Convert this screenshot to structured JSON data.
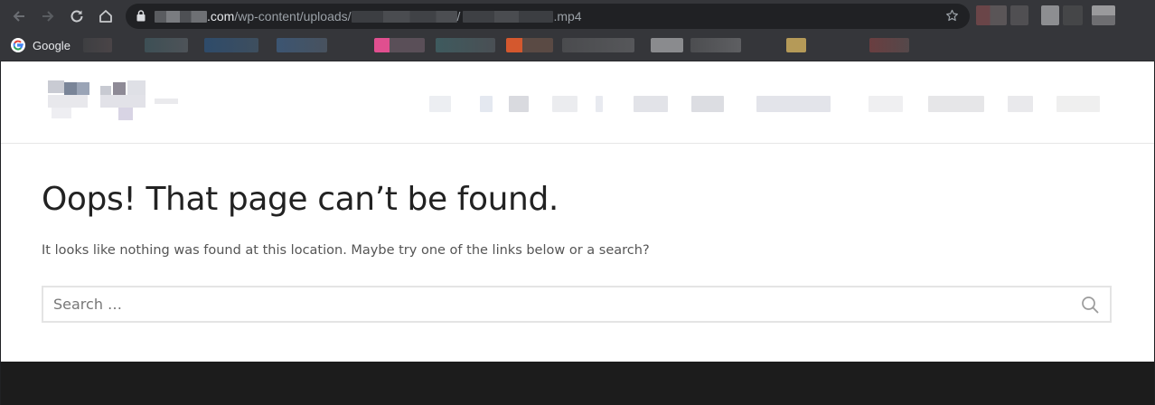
{
  "browser": {
    "url_domain_suffix": ".com",
    "url_path_prefix": "/wp-content/uploads/",
    "url_separator": "/",
    "url_file_ext": ".mp4",
    "icons": {
      "back": "arrow-left-icon",
      "forward": "arrow-right-icon",
      "reload": "reload-icon",
      "home": "home-icon",
      "lock": "lock-icon",
      "bookmark": "star-icon"
    }
  },
  "bookmarks_bar": {
    "google_label": "Google"
  },
  "page": {
    "title": "Oops! That page can’t be found.",
    "message": "It looks like nothing was found at this location. Maybe try one of the links below or a search?",
    "search": {
      "placeholder": "Search …",
      "value": ""
    }
  },
  "colors": {
    "chrome_bg": "#35363a",
    "omnibox_bg": "#202124",
    "page_bg": "#ffffff",
    "footer_bg": "#1c1c1c",
    "title_text": "#222222"
  }
}
